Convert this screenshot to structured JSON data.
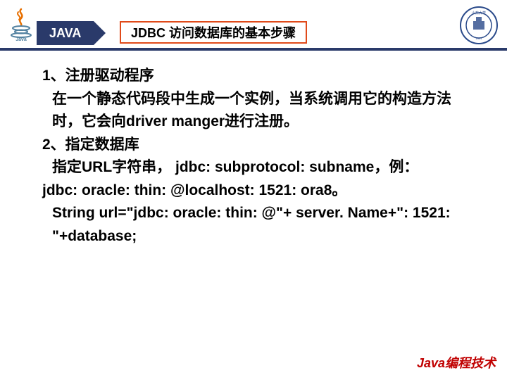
{
  "header": {
    "java_label": "JAVA",
    "title": "JDBC 访问数据库的基本步骤"
  },
  "content": {
    "step1_title": "1、注册驱动程序",
    "step1_body": "在一个静态代码段中生成一个实例，当系统调用它的构造方法时，它会向driver manger进行注册。",
    "step2_title": "2、指定数据库",
    "step2_body1": "指定URL字符串， jdbc: subprotocol: subname，例：",
    "step2_body2": "jdbc: oracle: thin: @localhost: 1521: ora8。",
    "step2_body3": "String url=\"jdbc: oracle: thin: @\"+ server. Name+\": 1521: \"+database;"
  },
  "footer": {
    "text": "Java编程技术"
  },
  "icons": {
    "java_logo": "java-logo-icon",
    "seal": "university-seal-icon"
  }
}
